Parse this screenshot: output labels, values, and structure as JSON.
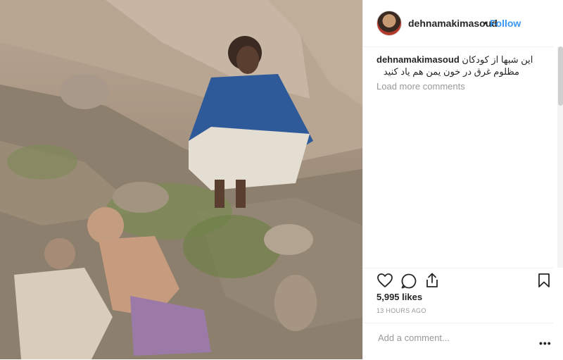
{
  "post": {
    "image_alt": "photo of a man seated on rocks beside two children lying on the ground"
  },
  "header": {
    "username": "dehnamakimasoud",
    "separator": "•",
    "follow_label": "Follow"
  },
  "caption": {
    "username": "dehnamakimasoud",
    "text_line1": "این شبها از کودکان",
    "text_line2": "مظلوم غرق در خون یمن هم یاد کنید"
  },
  "comments": {
    "load_more_label": "Load more comments"
  },
  "actions": {
    "like_icon": "heart-icon",
    "comment_icon": "comment-bubble-icon",
    "share_icon": "share-icon",
    "save_icon": "bookmark-icon"
  },
  "stats": {
    "likes": "5,995 likes",
    "timestamp": "13 HOURS AGO"
  },
  "comment_box": {
    "placeholder": "Add a comment...",
    "more_label": "•••"
  },
  "colors": {
    "link": "#3897f0",
    "text": "#262626",
    "muted": "#999999"
  }
}
